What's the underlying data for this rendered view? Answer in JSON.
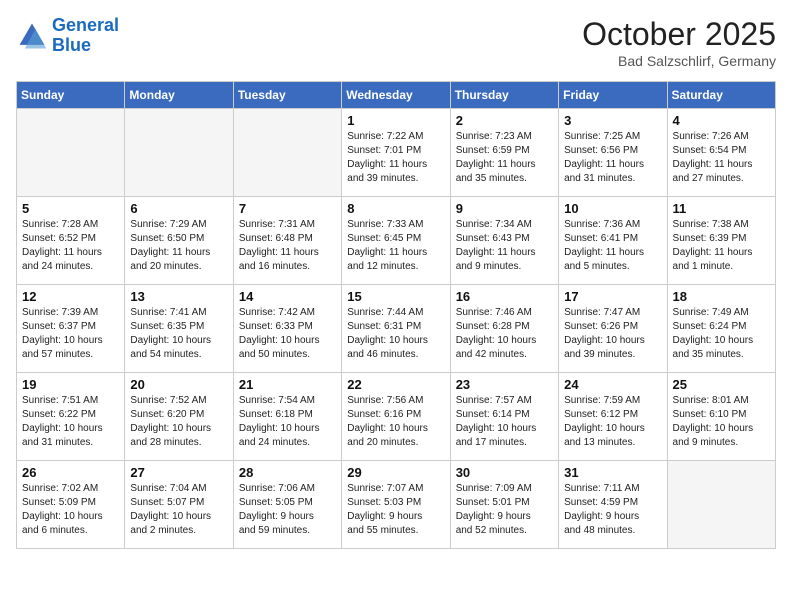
{
  "header": {
    "logo_line1": "General",
    "logo_line2": "Blue",
    "month": "October 2025",
    "location": "Bad Salzschlirf, Germany"
  },
  "weekdays": [
    "Sunday",
    "Monday",
    "Tuesday",
    "Wednesday",
    "Thursday",
    "Friday",
    "Saturday"
  ],
  "weeks": [
    [
      {
        "day": "",
        "info": "",
        "empty": true
      },
      {
        "day": "",
        "info": "",
        "empty": true
      },
      {
        "day": "",
        "info": "",
        "empty": true
      },
      {
        "day": "1",
        "info": "Sunrise: 7:22 AM\nSunset: 7:01 PM\nDaylight: 11 hours\nand 39 minutes."
      },
      {
        "day": "2",
        "info": "Sunrise: 7:23 AM\nSunset: 6:59 PM\nDaylight: 11 hours\nand 35 minutes."
      },
      {
        "day": "3",
        "info": "Sunrise: 7:25 AM\nSunset: 6:56 PM\nDaylight: 11 hours\nand 31 minutes."
      },
      {
        "day": "4",
        "info": "Sunrise: 7:26 AM\nSunset: 6:54 PM\nDaylight: 11 hours\nand 27 minutes."
      }
    ],
    [
      {
        "day": "5",
        "info": "Sunrise: 7:28 AM\nSunset: 6:52 PM\nDaylight: 11 hours\nand 24 minutes."
      },
      {
        "day": "6",
        "info": "Sunrise: 7:29 AM\nSunset: 6:50 PM\nDaylight: 11 hours\nand 20 minutes."
      },
      {
        "day": "7",
        "info": "Sunrise: 7:31 AM\nSunset: 6:48 PM\nDaylight: 11 hours\nand 16 minutes."
      },
      {
        "day": "8",
        "info": "Sunrise: 7:33 AM\nSunset: 6:45 PM\nDaylight: 11 hours\nand 12 minutes."
      },
      {
        "day": "9",
        "info": "Sunrise: 7:34 AM\nSunset: 6:43 PM\nDaylight: 11 hours\nand 9 minutes."
      },
      {
        "day": "10",
        "info": "Sunrise: 7:36 AM\nSunset: 6:41 PM\nDaylight: 11 hours\nand 5 minutes."
      },
      {
        "day": "11",
        "info": "Sunrise: 7:38 AM\nSunset: 6:39 PM\nDaylight: 11 hours\nand 1 minute."
      }
    ],
    [
      {
        "day": "12",
        "info": "Sunrise: 7:39 AM\nSunset: 6:37 PM\nDaylight: 10 hours\nand 57 minutes."
      },
      {
        "day": "13",
        "info": "Sunrise: 7:41 AM\nSunset: 6:35 PM\nDaylight: 10 hours\nand 54 minutes."
      },
      {
        "day": "14",
        "info": "Sunrise: 7:42 AM\nSunset: 6:33 PM\nDaylight: 10 hours\nand 50 minutes."
      },
      {
        "day": "15",
        "info": "Sunrise: 7:44 AM\nSunset: 6:31 PM\nDaylight: 10 hours\nand 46 minutes."
      },
      {
        "day": "16",
        "info": "Sunrise: 7:46 AM\nSunset: 6:28 PM\nDaylight: 10 hours\nand 42 minutes."
      },
      {
        "day": "17",
        "info": "Sunrise: 7:47 AM\nSunset: 6:26 PM\nDaylight: 10 hours\nand 39 minutes."
      },
      {
        "day": "18",
        "info": "Sunrise: 7:49 AM\nSunset: 6:24 PM\nDaylight: 10 hours\nand 35 minutes."
      }
    ],
    [
      {
        "day": "19",
        "info": "Sunrise: 7:51 AM\nSunset: 6:22 PM\nDaylight: 10 hours\nand 31 minutes."
      },
      {
        "day": "20",
        "info": "Sunrise: 7:52 AM\nSunset: 6:20 PM\nDaylight: 10 hours\nand 28 minutes."
      },
      {
        "day": "21",
        "info": "Sunrise: 7:54 AM\nSunset: 6:18 PM\nDaylight: 10 hours\nand 24 minutes."
      },
      {
        "day": "22",
        "info": "Sunrise: 7:56 AM\nSunset: 6:16 PM\nDaylight: 10 hours\nand 20 minutes."
      },
      {
        "day": "23",
        "info": "Sunrise: 7:57 AM\nSunset: 6:14 PM\nDaylight: 10 hours\nand 17 minutes."
      },
      {
        "day": "24",
        "info": "Sunrise: 7:59 AM\nSunset: 6:12 PM\nDaylight: 10 hours\nand 13 minutes."
      },
      {
        "day": "25",
        "info": "Sunrise: 8:01 AM\nSunset: 6:10 PM\nDaylight: 10 hours\nand 9 minutes."
      }
    ],
    [
      {
        "day": "26",
        "info": "Sunrise: 7:02 AM\nSunset: 5:09 PM\nDaylight: 10 hours\nand 6 minutes."
      },
      {
        "day": "27",
        "info": "Sunrise: 7:04 AM\nSunset: 5:07 PM\nDaylight: 10 hours\nand 2 minutes."
      },
      {
        "day": "28",
        "info": "Sunrise: 7:06 AM\nSunset: 5:05 PM\nDaylight: 9 hours\nand 59 minutes."
      },
      {
        "day": "29",
        "info": "Sunrise: 7:07 AM\nSunset: 5:03 PM\nDaylight: 9 hours\nand 55 minutes."
      },
      {
        "day": "30",
        "info": "Sunrise: 7:09 AM\nSunset: 5:01 PM\nDaylight: 9 hours\nand 52 minutes."
      },
      {
        "day": "31",
        "info": "Sunrise: 7:11 AM\nSunset: 4:59 PM\nDaylight: 9 hours\nand 48 minutes."
      },
      {
        "day": "",
        "info": "",
        "empty": true
      }
    ]
  ]
}
